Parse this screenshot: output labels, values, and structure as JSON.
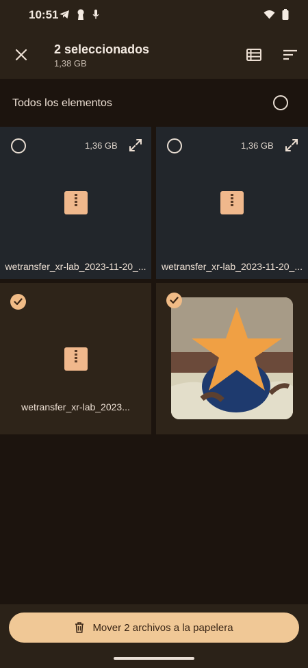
{
  "status_bar": {
    "time": "10:51",
    "icons_left": [
      "telegram-icon",
      "keyhole-icon",
      "mic-icon"
    ],
    "icons_right": [
      "wifi-icon",
      "battery-icon"
    ]
  },
  "app_bar": {
    "title": "2 seleccionados",
    "subtitle": "1,38 GB",
    "close_icon": "close-icon",
    "list_view_icon": "list-view-icon",
    "sort_icon": "sort-icon"
  },
  "select_all": {
    "label": "Todos los elementos",
    "checked": false
  },
  "grid": {
    "items": [
      {
        "name": "wetransfer_xr-lab_2023-11-20_...",
        "size": "1,36 GB",
        "selected": false,
        "type": "zip"
      },
      {
        "name": "wetransfer_xr-lab_2023-11-20_...",
        "size": "1,36 GB",
        "selected": false,
        "type": "zip"
      },
      {
        "name": "wetransfer_xr-lab_2023...",
        "size": "",
        "selected": true,
        "type": "zip"
      },
      {
        "name": "",
        "size": "",
        "selected": true,
        "type": "image"
      }
    ]
  },
  "bottom": {
    "action_label": "Mover 2 archivos a la papelera",
    "action_icon": "trash-icon"
  },
  "colors": {
    "accent": "#f0c896",
    "check": "#f0bb86",
    "zip": "#f0b88c",
    "background": "#1c140e",
    "surface": "#2b2218"
  }
}
